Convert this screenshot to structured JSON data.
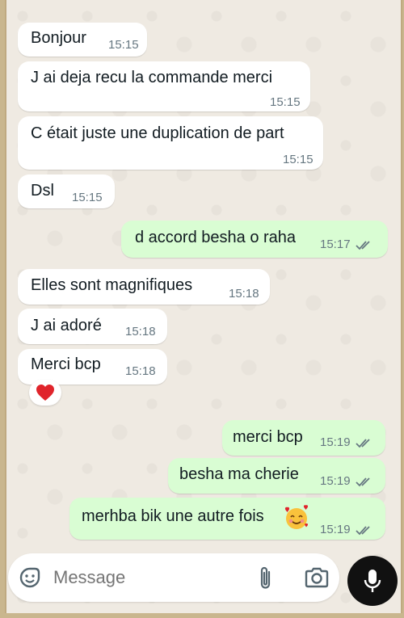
{
  "messages": [
    {
      "dir": "in",
      "text": "Bonjour",
      "time": "15:15"
    },
    {
      "dir": "in",
      "text": "J ai deja recu la commande merci",
      "time": "15:15"
    },
    {
      "dir": "in",
      "text": "C était juste une duplication de part",
      "time": "15:15"
    },
    {
      "dir": "in",
      "text": "Dsl",
      "time": "15:15"
    },
    {
      "dir": "out",
      "text": "d accord besha o raha",
      "time": "15:17"
    },
    {
      "dir": "in",
      "text": "Elles sont magnifiques",
      "time": "15:18"
    },
    {
      "dir": "in",
      "text": "J ai adoré",
      "time": "15:18"
    },
    {
      "dir": "in",
      "text": "Merci bcp",
      "time": "15:18"
    },
    {
      "dir": "out",
      "text": "merci bcp",
      "time": "15:19"
    },
    {
      "dir": "out",
      "text": "besha ma cherie",
      "time": "15:19"
    },
    {
      "dir": "out",
      "text": "merhba bik une autre fois",
      "time": "15:19"
    }
  ],
  "reaction": "heart",
  "composer": {
    "placeholder": "Message"
  },
  "icons": {
    "emoji": "sticker-icon",
    "attach": "paperclip-icon",
    "camera": "camera-icon",
    "send": "microphone-icon",
    "read_receipt": "double-check-icon"
  },
  "colors": {
    "chat_background": "#efeae2",
    "incoming_bubble": "#ffffff",
    "outgoing_bubble": "#d9fdd3",
    "timestamp": "#667781",
    "mic_button": "#111111"
  }
}
